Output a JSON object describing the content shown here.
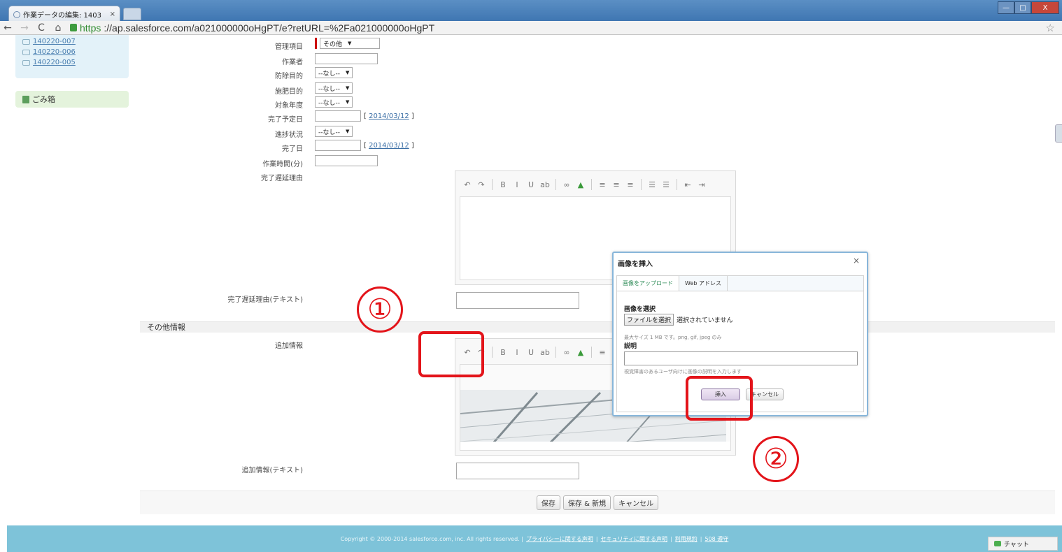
{
  "browser": {
    "tab_title": "作業データの編集: 1403",
    "tab_close": "×",
    "url_scheme": "https",
    "url_rest": "://ap.salesforce.com/a021000000oHgPT/e?retURL=%2Fa021000000oHgPT",
    "back": "←",
    "forward": "→",
    "reload": "C",
    "home": "⌂",
    "star": "☆",
    "win_min": "—",
    "win_max": "□",
    "win_close": "X"
  },
  "sidebar": {
    "recent": [
      "140220-007",
      "140220-006",
      "140220-005"
    ],
    "trash": "ごみ箱"
  },
  "form": {
    "rows": [
      {
        "label": "管理項目",
        "type": "select",
        "value": "その他"
      },
      {
        "label": "作業者",
        "type": "input"
      },
      {
        "label": "防除目的",
        "type": "select",
        "value": "--なし--"
      },
      {
        "label": "施肥目的",
        "type": "select",
        "value": "--なし--"
      },
      {
        "label": "対象年度",
        "type": "select",
        "value": "--なし--"
      },
      {
        "label": "完了予定日",
        "type": "date",
        "date": "2014/03/12"
      },
      {
        "label": "進捗状況",
        "type": "select",
        "value": "--なし--"
      },
      {
        "label": "完了日",
        "type": "date",
        "date": "2014/03/12"
      },
      {
        "label": "作業時間(分)",
        "type": "input"
      },
      {
        "label": "完了遅延理由",
        "type": "editor"
      }
    ],
    "delay_text_label": "完了遅延理由(テキスト)",
    "section_title": "その他情報",
    "additional_label": "追加情報",
    "additional_text_label": "追加情報(テキスト)",
    "buttons": {
      "save": "保存",
      "save_new": "保存 & 新規",
      "cancel": "キャンセル"
    }
  },
  "annotations": {
    "step1": "①",
    "step2": "②"
  },
  "dialog": {
    "title": "画像を挿入",
    "close": "×",
    "tabs": [
      "画像をアップロード",
      "Web アドレス"
    ],
    "select_image_label": "画像を選択",
    "choose_file": "ファイルを選択",
    "no_file": "選択されていません",
    "size_hint": "最大サイズ 1 MB です。png, gif, jpeg のみ",
    "description_label": "説明",
    "description_hint": "視覚障害のあるユーザ向けに画像の説明を入力します",
    "insert": "挿入",
    "cancel": "キャンセル"
  },
  "footer": {
    "copyright": "Copyright © 2000-2014 salesforce.com, inc. All rights reserved. |",
    "links": [
      "プライバシーに関する声明",
      "セキュリティに関する声明",
      "利用規約",
      "508 遵守"
    ]
  },
  "chat": {
    "label": "チャット"
  }
}
